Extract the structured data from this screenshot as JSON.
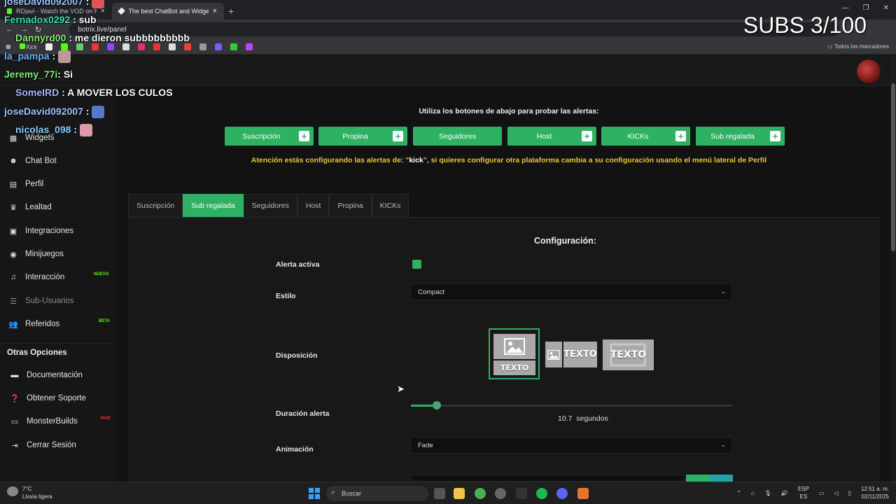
{
  "browser": {
    "tabs": [
      {
        "label": "RDjavi - Watch the VOD on Kick",
        "active": false
      },
      {
        "label": "The best ChatBot and Widgets",
        "active": true
      }
    ],
    "new_tab": "+",
    "url": "botrix.live/panel",
    "all_bookmarks": "Todos los marcadores",
    "kick_bookmark": "Kick"
  },
  "sidebar": {
    "items": [
      {
        "label": "Widgets",
        "icon": "widgets-icon"
      },
      {
        "label": "Chat Bot",
        "icon": "robot-icon"
      },
      {
        "label": "Perfil",
        "icon": "profile-card-icon"
      },
      {
        "label": "Lealtad",
        "icon": "trophy-icon"
      },
      {
        "label": "Integraciones",
        "icon": "integrations-icon"
      },
      {
        "label": "Minijuegos",
        "icon": "gamepad-icon"
      },
      {
        "label": "Interacción",
        "icon": "music-note-icon",
        "badge": "NUEVO"
      },
      {
        "label": "Sub-Usuarios",
        "icon": "sub-users-icon"
      },
      {
        "label": "Referidos",
        "icon": "referrals-icon",
        "badge": "BETA"
      }
    ],
    "other_title": "Otras Opciones",
    "other_items": [
      {
        "label": "Documentación",
        "icon": "book-icon"
      },
      {
        "label": "Obtener Soporte",
        "icon": "help-icon"
      },
      {
        "label": "MonsterBuilds",
        "icon": "laptop-icon",
        "badge": "PAID"
      },
      {
        "label": "Cerrar Sesión",
        "icon": "logout-icon"
      }
    ]
  },
  "main": {
    "instruction": "Utiliza los botones de abajo para probar las alertas:",
    "test_buttons": [
      "Suscripción",
      "Propina",
      "Seguidores",
      "Host",
      "KICKs",
      "Sub regalada"
    ],
    "warning_prefix": "Atención estás configurando las alertas de: \"",
    "warning_platform": "kick",
    "warning_suffix": "\", si quieres configurar otra plataforma cambia a su configuración usando el menú lateral de Perfil",
    "tabs": [
      "Suscripción",
      "Sub regalada",
      "Seguidores",
      "Host",
      "Propina",
      "KICKs"
    ],
    "active_tab": "Sub regalada"
  },
  "config": {
    "title": "Configuración:",
    "alerta_activa_label": "Alerta activa",
    "alerta_activa": true,
    "estilo_label": "Estilo",
    "estilo_value": "Compact",
    "disposicion_label": "Disposición",
    "layout_text": "TEXTO",
    "duracion_label": "Duración alerta",
    "duracion_value": "10.7",
    "duracion_unit": "segundos",
    "duracion_fraction": 0.08,
    "animacion_label": "Animación",
    "animacion_value": "Fade"
  },
  "overlay": {
    "subs_counter": "SUBS 3/100",
    "chat": [
      {
        "user": "joseDavid092007",
        "text": ":",
        "color": "#9ec3ff"
      },
      {
        "user": "Fernadox0292",
        "text": ": sub",
        "color": "#41e0b6"
      },
      {
        "user": "Dannyrd00",
        "text": ": me dieron subbbbbbbbb",
        "color": "#8ef07a"
      },
      {
        "user": "la_pampa",
        "text": ":",
        "color": "#6db3ff"
      },
      {
        "user": "Jeremy_77i",
        "text": ": Si",
        "color": "#7cf07c"
      },
      {
        "user": "SomeIRD",
        "text": ": A MOVER LOS CULOS",
        "color": "#a9b7ff"
      },
      {
        "user": "joseDavid092007",
        "text": ":",
        "color": "#9ec3ff"
      },
      {
        "user": "nicolas_098",
        "text": ":",
        "color": "#8bd0ff"
      }
    ]
  },
  "taskbar": {
    "temperature": "7°C",
    "weather": "Lluvia ligera",
    "search": "Buscar",
    "lang1": "ESP",
    "lang2": "ES",
    "time": "12:51 a. m.",
    "date": "02/11/2025"
  },
  "colors": {
    "accent": "#2fb163",
    "warning": "#e7c53a"
  }
}
